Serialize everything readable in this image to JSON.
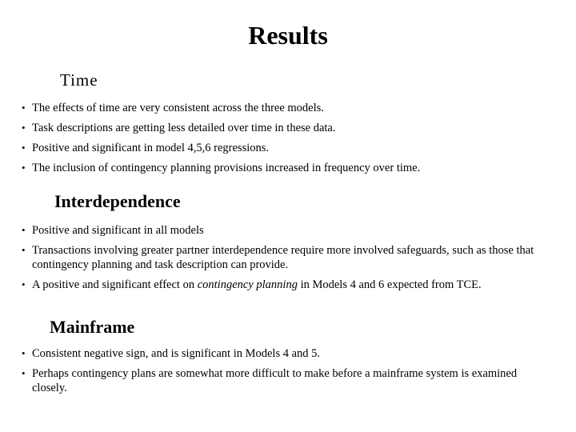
{
  "title": "Results",
  "sections": [
    {
      "heading": "Time",
      "bullets": [
        "The effects of time are very consistent across the three models.",
        "Task descriptions are getting less detailed over time in these data.",
        "Positive and significant in model 4,5,6 regressions.",
        "The inclusion of contingency planning provisions increased in frequency over time."
      ]
    },
    {
      "heading": "Interdependence",
      "bullets": [
        "Positive and significant in all models",
        "Transactions involving greater partner interdependence require more involved safeguards, such as those that contingency planning and task description can provide.",
        {
          "before": "A positive and significant effect on ",
          "emphasis": "contingency planning",
          "after": " in Models 4 and 6 expected from TCE."
        }
      ]
    },
    {
      "heading": "Mainframe",
      "bullets": [
        "Consistent negative sign, and is significant in Models 4 and 5.",
        "Perhaps contingency plans are somewhat more difficult to make before a mainframe system is examined closely."
      ]
    }
  ]
}
